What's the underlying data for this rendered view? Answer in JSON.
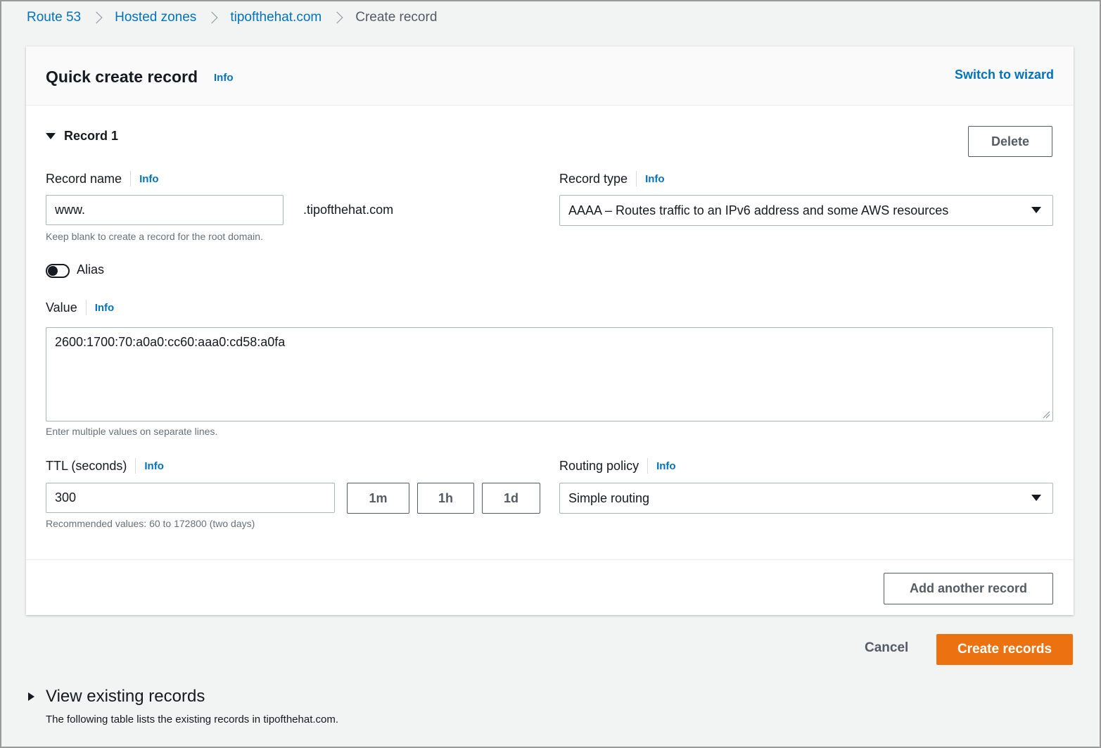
{
  "breadcrumb": {
    "items": [
      "Route 53",
      "Hosted zones",
      "tipofthehat.com"
    ],
    "current": "Create record"
  },
  "card": {
    "title": "Quick create record",
    "title_info": "Info",
    "switch_wizard": "Switch to wizard"
  },
  "record": {
    "heading": "Record 1",
    "delete_label": "Delete",
    "name": {
      "label": "Record name",
      "info": "Info",
      "value": "www.",
      "suffix": ".tipofthehat.com",
      "hint": "Keep blank to create a record for the root domain."
    },
    "type": {
      "label": "Record type",
      "info": "Info",
      "selected": "AAAA – Routes traffic to an IPv6 address and some AWS resources"
    },
    "alias": {
      "label": "Alias",
      "enabled": false
    },
    "value": {
      "label": "Value",
      "info": "Info",
      "text": "2600:1700:70:a0a0:cc60:aaa0:cd58:a0fa",
      "hint": "Enter multiple values on separate lines."
    },
    "ttl": {
      "label": "TTL (seconds)",
      "info": "Info",
      "value": "300",
      "presets": [
        "1m",
        "1h",
        "1d"
      ],
      "hint": "Recommended values: 60 to 172800 (two days)"
    },
    "routing": {
      "label": "Routing policy",
      "info": "Info",
      "selected": "Simple routing"
    }
  },
  "footer": {
    "add_another": "Add another record"
  },
  "actions": {
    "cancel": "Cancel",
    "create": "Create records"
  },
  "existing": {
    "title": "View existing records",
    "description": "The following table lists the existing records in tipofthehat.com."
  },
  "colors": {
    "link": "#0073bb",
    "primary": "#ec7211"
  }
}
